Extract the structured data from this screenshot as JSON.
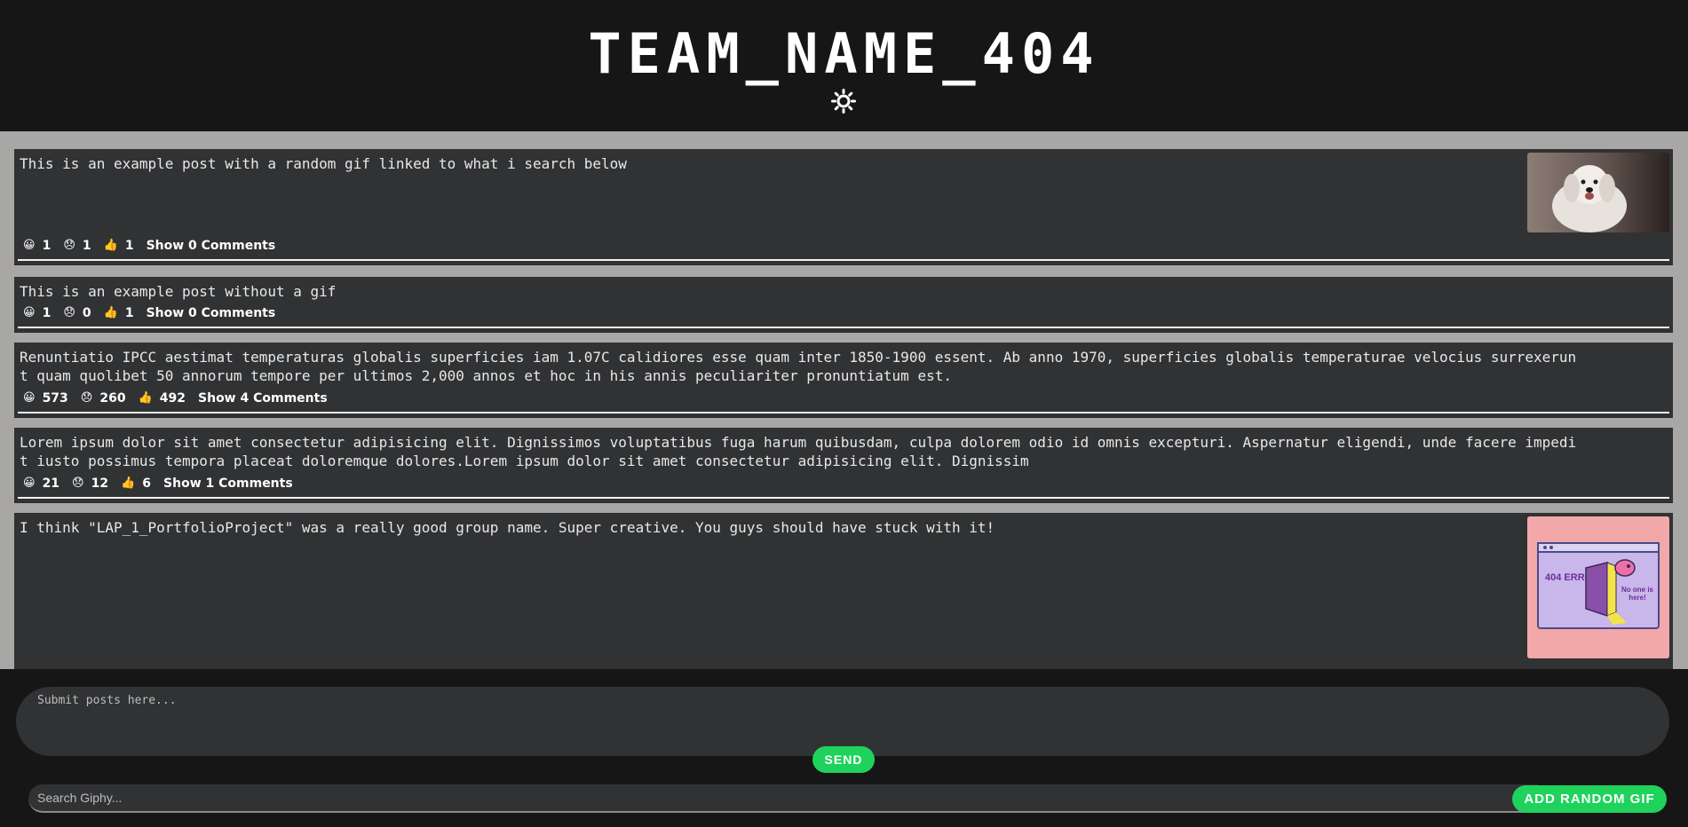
{
  "header": {
    "title": "TEAM_NAME_404",
    "theme_icon": "sun-icon"
  },
  "posts": [
    {
      "text": "This is an example post with a random gif linked to what i search below",
      "reactions": {
        "happy": "1",
        "sad": "1",
        "thumbs": "1"
      },
      "comments_label": "Show 0 Comments",
      "gif": "puppy-gif"
    },
    {
      "text": "This is an example post without a gif",
      "reactions": {
        "happy": "1",
        "sad": "0",
        "thumbs": "1"
      },
      "comments_label": "Show 0 Comments"
    },
    {
      "text": "Renuntiatio IPCC aestimat temperaturas globalis superficies iam 1.07C calidiores esse quam inter 1850-1900 essent. Ab anno 1970, superficies globalis temperaturae velocius surrexerunt quam quolibet 50 annorum tempore per ultimos 2,000 annos et hoc in his annis peculiariter pronuntiatum est.",
      "reactions": {
        "happy": "573",
        "sad": "260",
        "thumbs": "492"
      },
      "comments_label": "Show 4 Comments"
    },
    {
      "text": "Lorem ipsum dolor sit amet consectetur adipisicing elit. Dignissimos voluptatibus fuga harum quibusdam, culpa dolorem odio id omnis excepturi. Aspernatur eligendi, unde facere impedit iusto possimus tempora placeat doloremque dolores.Lorem ipsum dolor sit amet consectetur adipisicing elit. Dignissim",
      "reactions": {
        "happy": "21",
        "sad": "12",
        "thumbs": "6"
      },
      "comments_label": "Show 1 Comments"
    },
    {
      "text": "I think \"LAP_1_PortfolioProject\" was a really good group name. Super creative. You guys should have stuck with it!",
      "gif": "404-error-gif",
      "gif_text": {
        "error": "404 ERROR!",
        "note": "No one is here!"
      }
    }
  ],
  "composer": {
    "post_placeholder": "Submit posts here...",
    "send_label": "SEND",
    "search_placeholder": "Search Giphy...",
    "gif_button_label": "ADD RANDOM GIF"
  },
  "colors": {
    "accent": "#1fd25c",
    "background": "#161616",
    "feed_background": "#a9a7a5",
    "post_background": "#313234"
  }
}
